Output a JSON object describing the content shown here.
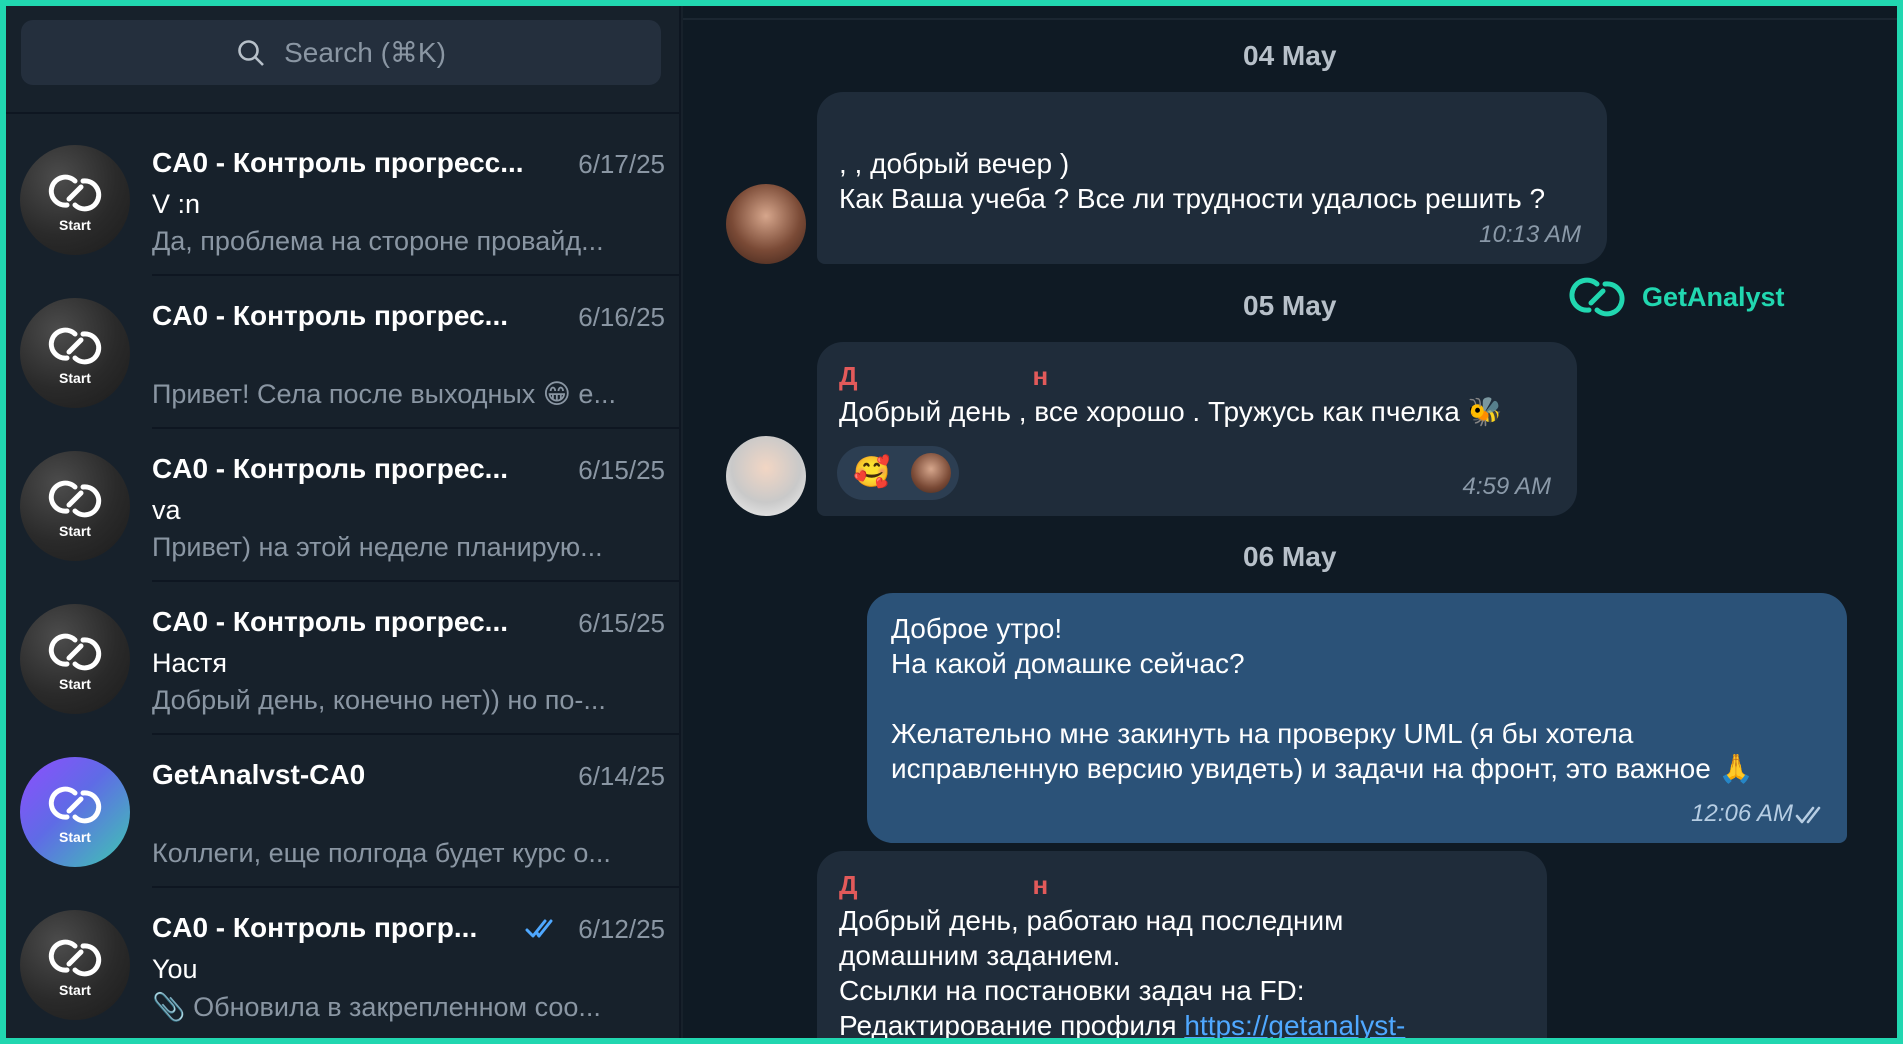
{
  "search": {
    "placeholder": "Search (⌘K)"
  },
  "chats": [
    {
      "title": "CA0 - Контроль прогресс...",
      "date": "6/17/25",
      "sender": "V                             :n",
      "preview": "Да, проблема на стороне провайд...",
      "avatar_label": "Start"
    },
    {
      "title": "CA0 - Контроль прогрес...",
      "date": "6/16/25",
      "sender": "",
      "preview": "Привет! Села после выходных 😁  е...",
      "avatar_label": "Start"
    },
    {
      "title": "CA0 - Контроль прогрес...",
      "date": "6/15/25",
      "sender": "                           va",
      "preview": "Привет) на этой неделе планирую...",
      "avatar_label": "Start"
    },
    {
      "title": "CA0 - Контроль прогрес...",
      "date": "6/15/25",
      "sender": "Настя",
      "preview": "Добрый день, конечно нет)) но по-...",
      "avatar_label": "Start"
    },
    {
      "title": "GetAnalvst-CA0",
      "date": "6/14/25",
      "sender": "",
      "preview": "Коллеги, еще полгода будет курс о...",
      "avatar_label": "Start"
    },
    {
      "title": "CA0 - Контроль прогр...",
      "date": "6/12/25",
      "sender": "You",
      "preview": "📎 Обновила в закрепленном соо...",
      "avatar_label": "Start",
      "read": true
    }
  ],
  "messages": {
    "date1": "04 May",
    "m1_line1": ",         , добрый вечер )",
    "m1_line2": "Как Ваша учеба ? Все ли трудности удалось решить ?",
    "m1_time": "10:13 AM",
    "date2": "05 May",
    "m2_name_first": "Д",
    "m2_name_last": "н",
    "m2_text": "Добрый день , все хорошо . Тружусь как пчелка 🐝",
    "m2_reaction": "🥰",
    "m2_time": "4:59 AM",
    "date3": "06 May",
    "m3_line1": "Доброе утро!",
    "m3_line2": "На какой домашке сейчас?",
    "m3_line3": "Желательно мне закинуть на проверку UML (я бы хотела",
    "m3_line4": "исправленную версию увидеть) и задачи на фронт, это важное 🙏",
    "m3_time": "12:06 AM",
    "m4_name_first": "Д",
    "m4_name_last": "н",
    "m4_line1": "Добрый день, работаю над последним",
    "m4_line2": "домашним заданием.",
    "m4_line3": "Ссылки на постановки задач на FD:",
    "m4_line4": "Редактирование профиля ",
    "m4_link": "https://getanalyst-"
  },
  "watermark": {
    "text": "GetAnalyst"
  },
  "colors": {
    "accent": "#21d7b0",
    "sender_name": "#e25a5a",
    "outgoing_bubble": "#2b5278",
    "incoming_bubble": "#1f2c3a",
    "link": "#4fa8ff"
  }
}
